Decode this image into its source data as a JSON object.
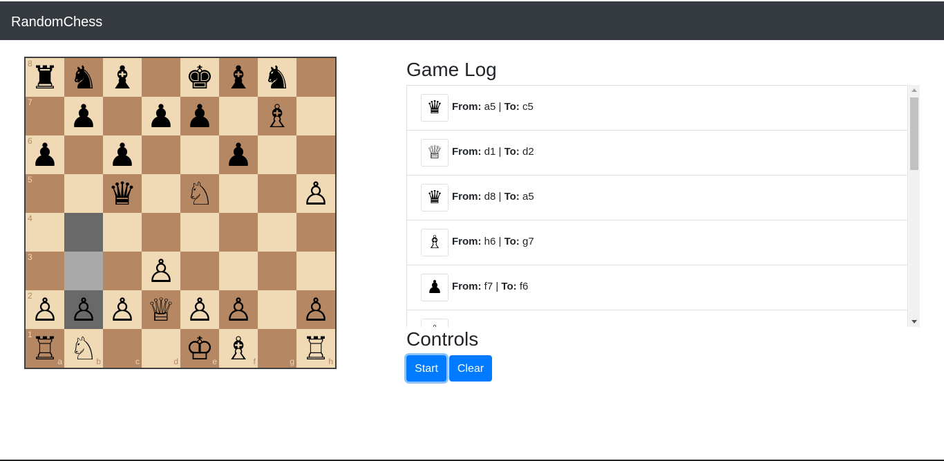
{
  "app": {
    "title": "RandomChess"
  },
  "colors": {
    "light": "#f0d9b5",
    "dark": "#b58863",
    "highlight_from": "#a9a9a9",
    "highlight_to": "#696969"
  },
  "board": {
    "ranks": [
      "8",
      "7",
      "6",
      "5",
      "4",
      "3",
      "2",
      "1"
    ],
    "files": [
      "a",
      "b",
      "c",
      "d",
      "e",
      "f",
      "g",
      "h"
    ],
    "rows": [
      [
        "r",
        "n",
        "b",
        "",
        "k",
        "b",
        "n",
        ""
      ],
      [
        "",
        "p",
        "",
        "p",
        "p",
        "",
        "B",
        ""
      ],
      [
        "p",
        "",
        "p",
        "",
        "",
        "p",
        "",
        ""
      ],
      [
        "",
        "",
        "q",
        "",
        "N",
        "",
        "",
        "P"
      ],
      [
        "",
        "",
        "",
        "",
        "",
        "",
        "",
        ""
      ],
      [
        "",
        "",
        "",
        "P",
        "",
        "",
        "",
        ""
      ],
      [
        "P",
        "P",
        "P",
        "Q",
        "P",
        "P",
        "",
        "P"
      ],
      [
        "R",
        "N",
        "",
        "",
        "K",
        "B",
        "",
        "R"
      ]
    ],
    "highlighted": [
      {
        "square": "b4",
        "kind": "to"
      },
      {
        "square": "b3",
        "kind": "from"
      },
      {
        "square": "b2",
        "kind": "to"
      }
    ]
  },
  "log": {
    "heading": "Game Log",
    "from_label": "From:",
    "to_label": "To:",
    "entries": [
      {
        "piece": "black-queen",
        "glyph": "♛",
        "from": "a5",
        "to": "c5"
      },
      {
        "piece": "white-queen",
        "glyph": "♕",
        "from": "d1",
        "to": "d2"
      },
      {
        "piece": "black-queen",
        "glyph": "♛",
        "from": "d8",
        "to": "a5"
      },
      {
        "piece": "white-bishop",
        "glyph": "♗",
        "from": "h6",
        "to": "g7"
      },
      {
        "piece": "black-pawn",
        "glyph": "♟",
        "from": "f7",
        "to": "f6"
      },
      {
        "piece": "white-bishop",
        "glyph": "♗",
        "from": "",
        "to": ""
      }
    ]
  },
  "controls": {
    "heading": "Controls",
    "start_label": "Start",
    "clear_label": "Clear"
  }
}
